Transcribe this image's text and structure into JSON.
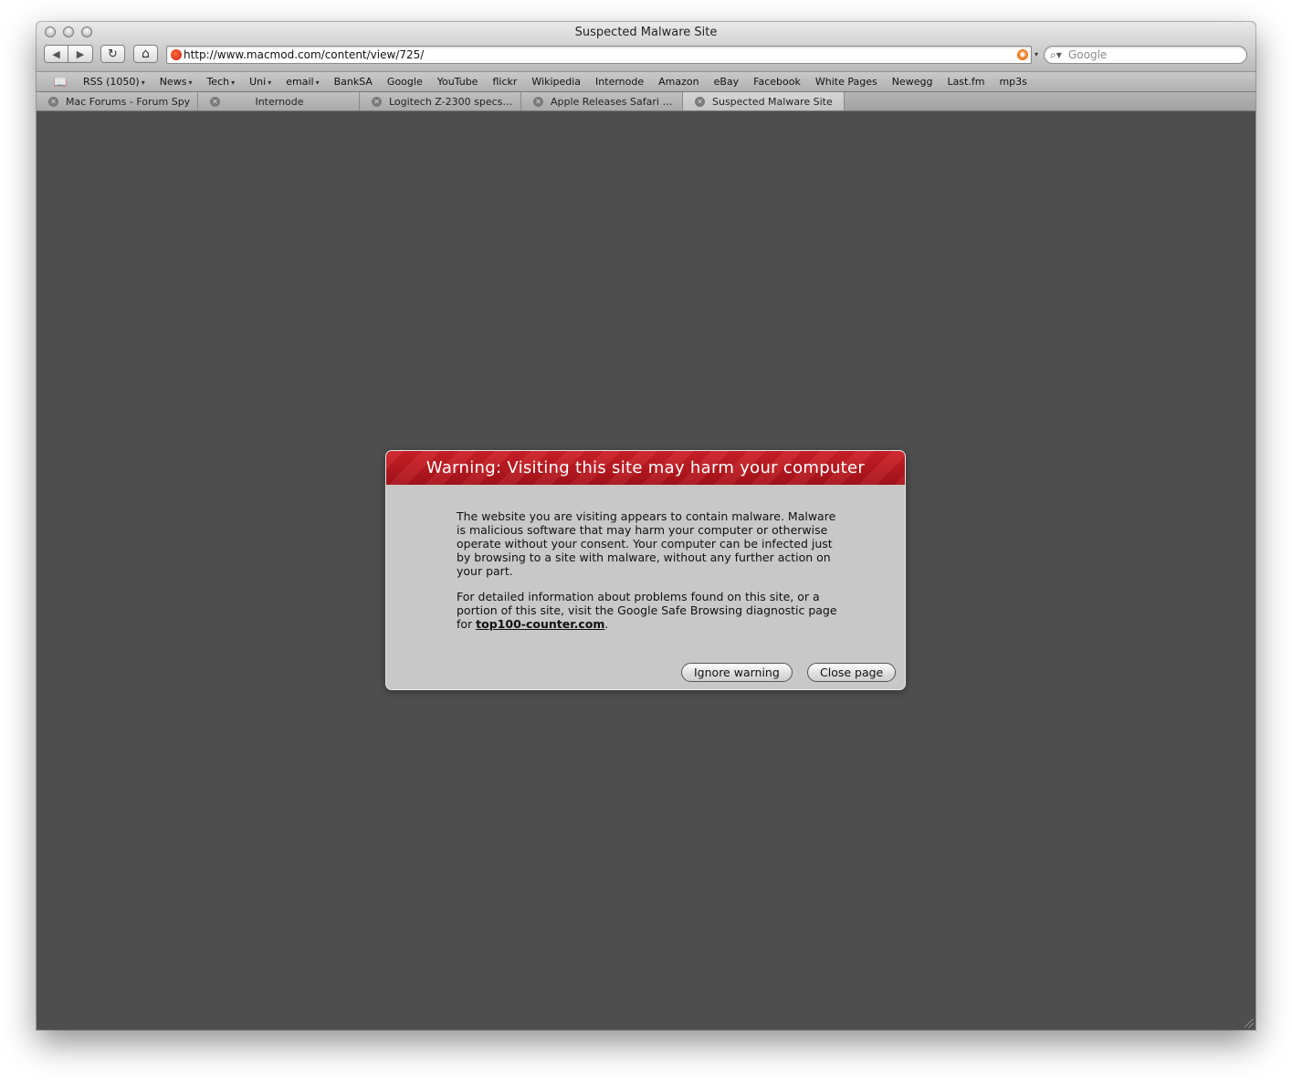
{
  "window": {
    "title": "Suspected Malware Site"
  },
  "toolbar": {
    "back_icon": "◀",
    "forward_icon": "▶",
    "reload_icon": "↻",
    "home_icon": "⌂",
    "url": "http://www.macmod.com/content/view/725/",
    "search_placeholder": "Google"
  },
  "bookmarks": [
    {
      "label": "RSS (1050)",
      "caret": "▾"
    },
    {
      "label": "News",
      "caret": "▾"
    },
    {
      "label": "Tech",
      "caret": "▾"
    },
    {
      "label": "Uni",
      "caret": "▾"
    },
    {
      "label": "email",
      "caret": "▾"
    },
    {
      "label": "BankSA",
      "caret": ""
    },
    {
      "label": "Google",
      "caret": ""
    },
    {
      "label": "YouTube",
      "caret": ""
    },
    {
      "label": "flickr",
      "caret": ""
    },
    {
      "label": "Wikipedia",
      "caret": ""
    },
    {
      "label": "Internode",
      "caret": ""
    },
    {
      "label": "Amazon",
      "caret": ""
    },
    {
      "label": "eBay",
      "caret": ""
    },
    {
      "label": "Facebook",
      "caret": ""
    },
    {
      "label": "White Pages",
      "caret": ""
    },
    {
      "label": "Newegg",
      "caret": ""
    },
    {
      "label": "Last.fm",
      "caret": ""
    },
    {
      "label": "mp3s",
      "caret": ""
    }
  ],
  "tabs": [
    {
      "label": "Mac Forums - Forum Spy",
      "active": false
    },
    {
      "label": "Internode",
      "active": false
    },
    {
      "label": "Logitech Z-2300 specs ...",
      "active": false
    },
    {
      "label": "Apple Releases Safari 3....",
      "active": false
    },
    {
      "label": "Suspected Malware Site",
      "active": true
    }
  ],
  "dialog": {
    "title": "Warning: Visiting this site may harm your computer",
    "paragraph1": "The website you are visiting appears to contain malware. Malware is malicious software that may harm your computer or otherwise operate without your consent. Your computer can be infected just by browsing to a site with malware, without any further action on your part.",
    "paragraph2_prefix": "For detailed information about problems found on this site, or a portion of this site, visit the Google Safe Browsing diagnostic page for ",
    "link": "top100-counter.com",
    "paragraph2_suffix": ".",
    "ignore_label": "Ignore warning",
    "close_label": "Close page",
    "header_color": "#c01a22"
  }
}
